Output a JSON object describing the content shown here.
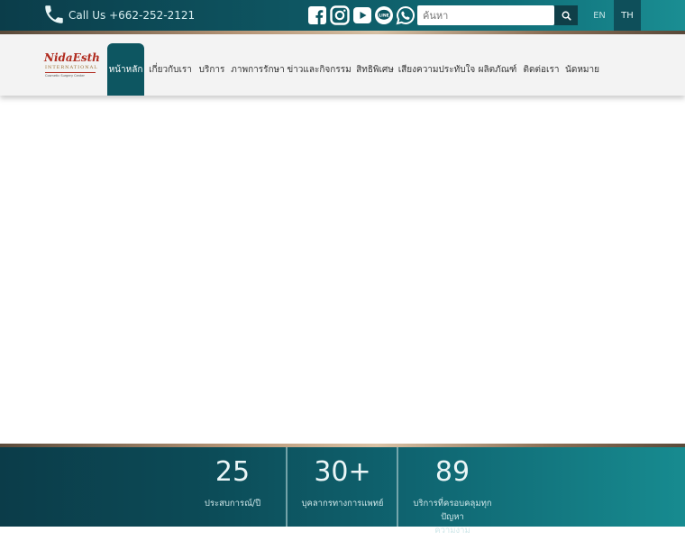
{
  "topbar": {
    "call_label": "Call Us",
    "phone": "+662-252-2121",
    "search_placeholder": "ค้นหา",
    "languages": [
      "EN",
      "TH"
    ],
    "active_language": "TH",
    "social_icons": [
      "facebook-icon",
      "instagram-icon",
      "youtube-icon",
      "line-icon",
      "whatsapp-icon"
    ]
  },
  "logo": {
    "name": "NidaEsth",
    "sub": "INTERNATIONAL",
    "tag": "Cosmetic Surgery Center"
  },
  "nav": {
    "items": [
      "หน้าหลัก",
      "เกี่ยวกับเรา",
      "บริการ",
      "ภาพการรักษา",
      "ข่าวและกิจกรรม",
      "สิทธิพิเศษ",
      "เสียงความประทับใจ",
      "ผลิตภัณฑ์",
      "ติดต่อเรา",
      "นัดหมาย"
    ],
    "active_index": 0
  },
  "stats": [
    {
      "value": "25",
      "label_lines": [
        "ประสบการณ์/ปี"
      ]
    },
    {
      "value": "30+",
      "label_lines": [
        "บุคลากรทางการแพทย์"
      ]
    },
    {
      "value": "89",
      "label_lines": [
        "บริการที่ครอบคลุมทุกปัญหา",
        "ความงาม"
      ]
    }
  ],
  "colors": {
    "teal_dark": "#0b3d4a",
    "teal_active": "#0d5661",
    "teal_light": "#1a8e93",
    "bronze": "#b89778",
    "logo_red": "#b02a1e"
  }
}
